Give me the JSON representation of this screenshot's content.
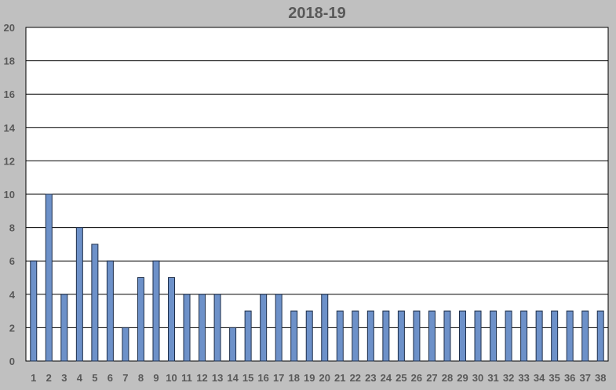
{
  "chart_data": {
    "type": "bar",
    "title": "2018-19",
    "xlabel": "",
    "ylabel": "",
    "ylim": [
      0,
      20
    ],
    "ytick_step": 2,
    "grid": true,
    "legend": "none",
    "categories": [
      "1",
      "2",
      "3",
      "4",
      "5",
      "6",
      "7",
      "8",
      "9",
      "10",
      "11",
      "12",
      "13",
      "14",
      "15",
      "16",
      "17",
      "18",
      "19",
      "20",
      "21",
      "22",
      "23",
      "24",
      "25",
      "26",
      "27",
      "28",
      "29",
      "30",
      "31",
      "32",
      "33",
      "34",
      "35",
      "36",
      "37",
      "38"
    ],
    "values": [
      6,
      10,
      4,
      8,
      7,
      6,
      2,
      5,
      6,
      5,
      4,
      4,
      4,
      2,
      3,
      4,
      4,
      3,
      3,
      4,
      3,
      3,
      3,
      3,
      3,
      3,
      3,
      3,
      3,
      3,
      3,
      3,
      3,
      3,
      3,
      3,
      3,
      3
    ],
    "colors": {
      "bar_fill": "#6d91c9",
      "bar_stroke": "#1f2f4a",
      "background": "#c0c0c0",
      "plot_background": "#ffffff",
      "gridline": "#000000",
      "text": "#595959"
    }
  }
}
